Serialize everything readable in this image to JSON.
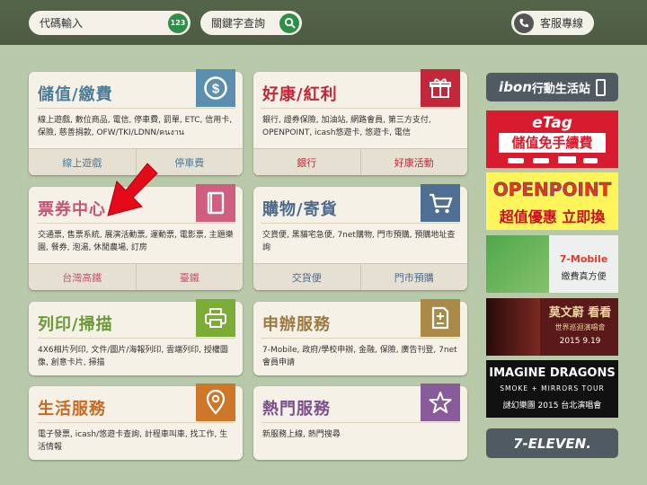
{
  "topbar": {
    "code_input": {
      "placeholder": "代碼輸入",
      "badge": "123"
    },
    "keyword_input": {
      "placeholder": "關鍵字查詢"
    },
    "service": {
      "label": "客服專線"
    }
  },
  "cards": [
    {
      "title": "儲值/繳費",
      "icon": "dollar-icon",
      "color": "#5a8faf",
      "desc": "線上遊戲, 數位商品, 電信, 停車費, 罰單, ETC, 信用卡, 保險, 慈善捐款, OFW/TKI/LDNN/คนงาน",
      "buttons": [
        "線上遊戲",
        "停車費"
      ]
    },
    {
      "title": "好康/紅利",
      "icon": "gift-icon",
      "color": "#c2283a",
      "desc": "銀行, 證券保險, 加油站, 網路會員, 第三方支付, OPENPOINT, icash悠遊卡, 悠遊卡, 電信",
      "buttons": [
        "銀行",
        "好康活動"
      ]
    },
    {
      "title": "票券中心",
      "icon": "ticket-icon",
      "color": "#cf5e7f",
      "desc": "交通票, 售票系統, 展演活動票, 運動票, 電影票, 主題樂園, 餐券, 泡湯, 休閒農場, 訂房",
      "buttons": [
        "台灣高鐵",
        "臺鐵"
      ]
    },
    {
      "title": "購物/寄貨",
      "icon": "cart-icon",
      "color": "#4e6e94",
      "desc": "交貨便, 黑貓宅急便, 7net購物, 門市預購, 預購地址查詢",
      "buttons": [
        "交貨便",
        "門市預購"
      ]
    },
    {
      "title": "列印/掃描",
      "icon": "printer-icon",
      "color": "#7bac36",
      "desc": "4X6相片列印, 文件/圖片/海報列印, 雲端列印, 授權圖像, 創意卡片, 掃描"
    },
    {
      "title": "申辦服務",
      "icon": "form-icon",
      "color": "#ab8947",
      "desc": "7-Mobile, 政府/學校申辦, 金融, 保險, 廣告刊登, 7net會員申請"
    },
    {
      "title": "生活服務",
      "icon": "location-icon",
      "color": "#cf7728",
      "desc": "電子發票, icash/悠遊卡查詢, 計程車叫車, 找工作, 生活情報"
    },
    {
      "title": "熱門服務",
      "icon": "star-icon",
      "color": "#8a5b9b",
      "desc": "新服務上線, 熱門搜尋"
    }
  ],
  "side": {
    "ibon": {
      "brand": "ibon",
      "label": "行動生活站"
    },
    "etag": {
      "brand": "eTag",
      "tagline": "儲值免手續費"
    },
    "openpoint": {
      "brand": "OPENPOINT",
      "tagline": "超值優惠 立即換"
    },
    "mobile": {
      "brand": "7-Mobile",
      "tagline": "繳費真方便"
    },
    "concert": {
      "artist": "莫文蔚",
      "show": "看看",
      "sub": "世界巡迴演唱會",
      "date": "2015 9.19"
    },
    "imagine": {
      "band": "IMAGINE DRAGONS",
      "tour": "SMOKE + MIRRORS TOUR",
      "cn": "謎幻樂團 2015 台北演唱會"
    },
    "seven": {
      "label": "7-ELEVEN."
    }
  }
}
